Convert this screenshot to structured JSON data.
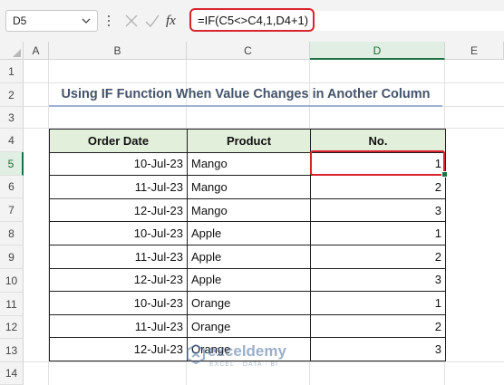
{
  "name_box": {
    "value": "D5"
  },
  "formula_bar": {
    "formula": "=IF(C5<>C4,1,D4+1)",
    "fx_label": "fx"
  },
  "columns": [
    "A",
    "B",
    "C",
    "D",
    "E"
  ],
  "selected_column": "D",
  "rows": [
    "1",
    "2",
    "3",
    "4",
    "5",
    "6",
    "7",
    "8",
    "9",
    "10",
    "11",
    "12",
    "13",
    "14"
  ],
  "selected_row": "5",
  "sheet_title": "Using IF Function When Value Changes in Another Column",
  "table": {
    "headers": {
      "date": "Order Date",
      "product": "Product",
      "no": "No."
    },
    "rows": [
      {
        "date": "10-Jul-23",
        "product": "Mango",
        "no": "1"
      },
      {
        "date": "11-Jul-23",
        "product": "Mango",
        "no": "2"
      },
      {
        "date": "12-Jul-23",
        "product": "Mango",
        "no": "3"
      },
      {
        "date": "10-Jul-23",
        "product": "Apple",
        "no": "1"
      },
      {
        "date": "11-Jul-23",
        "product": "Apple",
        "no": "2"
      },
      {
        "date": "12-Jul-23",
        "product": "Apple",
        "no": "3"
      },
      {
        "date": "10-Jul-23",
        "product": "Orange",
        "no": "1"
      },
      {
        "date": "11-Jul-23",
        "product": "Orange",
        "no": "2"
      },
      {
        "date": "12-Jul-23",
        "product": "Orange",
        "no": "3"
      }
    ]
  },
  "watermark": {
    "name": "exceldemy",
    "tagline": "EXCEL · DATA · BI"
  },
  "colors": {
    "accent_red": "#d9232e",
    "header_fill": "#e2efda",
    "excel_green": "#1e7145"
  }
}
